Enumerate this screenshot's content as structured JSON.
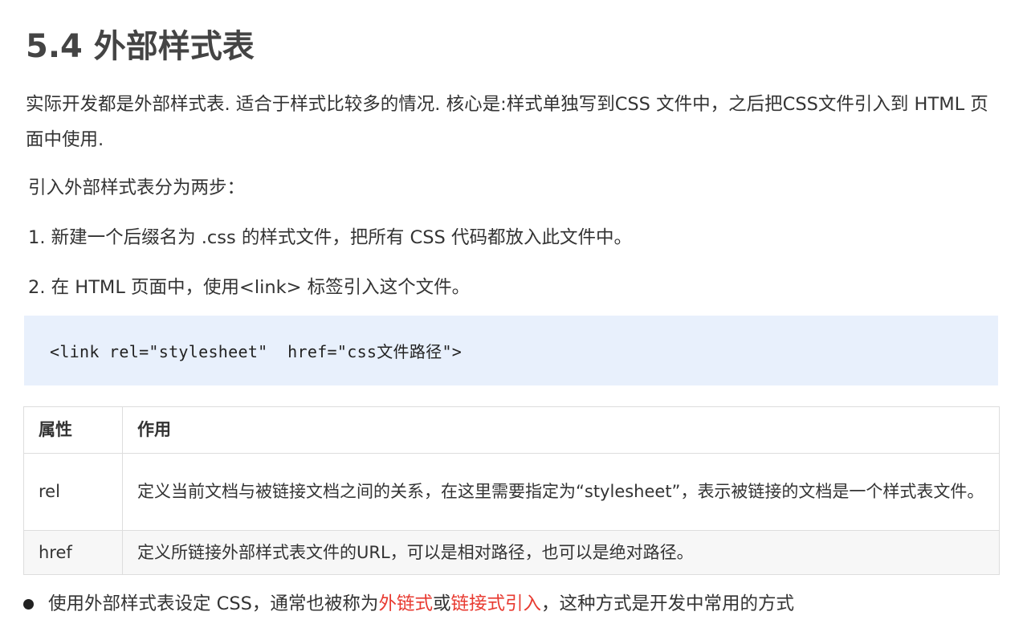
{
  "title": "5.4 外部样式表",
  "intro": "实际开发都是外部样式表. 适合于样式比较多的情况. 核心是:样式单独写到CSS 文件中，之后把CSS文件引入到 HTML 页面中使用.",
  "steps_intro": "引入外部样式表分为两步：",
  "steps": [
    "1. 新建一个后缀名为 .css 的样式文件，把所有 CSS 代码都放入此文件中。",
    "2. 在 HTML 页面中，使用<link> 标签引入这个文件。"
  ],
  "code": "<link rel=\"stylesheet\"  href=\"css文件路径\">",
  "table": {
    "headers": [
      "属性",
      "作用"
    ],
    "rows": [
      [
        "rel",
        "定义当前文档与被链接文档之间的关系，在这里需要指定为“stylesheet”，表示被链接的文档是一个样式表文件。"
      ],
      [
        "href",
        "定义所链接外部样式表文件的URL，可以是相对路径，也可以是绝对路径。"
      ]
    ]
  },
  "bullet": {
    "prefix": "使用外部样式表设定 CSS，通常也被称为",
    "highlight_1": "外链式",
    "middle": "或",
    "highlight_2": "链接式引入",
    "suffix": "，这种方式是开发中常用的方式"
  },
  "colors": {
    "code_background": "#e8f0fc",
    "highlight": "#e83a30",
    "text": "#333333"
  }
}
